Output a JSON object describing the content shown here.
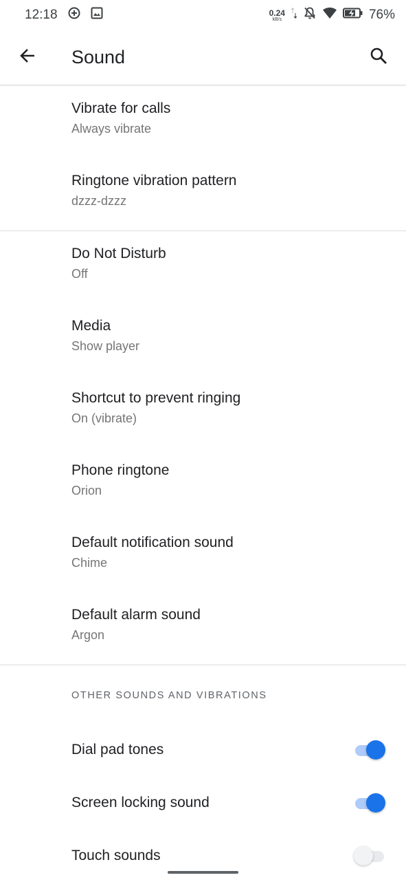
{
  "status_bar": {
    "time": "12:18",
    "net_speed_value": "0.24",
    "net_speed_unit": "kB/s",
    "battery": "76%",
    "icons": [
      "data-saver-icon",
      "image-icon",
      "upload-download-arrows-icon",
      "notifications-off-icon",
      "wifi-icon",
      "battery-charging-icon"
    ]
  },
  "app_bar": {
    "title": "Sound",
    "icons": [
      "back-arrow-icon",
      "search-icon"
    ]
  },
  "settings": {
    "vibrate_calls": {
      "title": "Vibrate for calls",
      "summary": "Always vibrate"
    },
    "ringtone_vibration": {
      "title": "Ringtone vibration pattern",
      "summary": "dzzz-dzzz"
    },
    "dnd": {
      "title": "Do Not Disturb",
      "summary": "Off"
    },
    "media": {
      "title": "Media",
      "summary": "Show player"
    },
    "prevent_ringing": {
      "title": "Shortcut to prevent ringing",
      "summary": "On (vibrate)"
    },
    "phone_ringtone": {
      "title": "Phone ringtone",
      "summary": "Orion"
    },
    "notification_sound": {
      "title": "Default notification sound",
      "summary": "Chime"
    },
    "alarm_sound": {
      "title": "Default alarm sound",
      "summary": "Argon"
    }
  },
  "other_section": {
    "header": "OTHER SOUNDS AND VIBRATIONS",
    "dial_pad": {
      "title": "Dial pad tones",
      "enabled": true
    },
    "screen_lock": {
      "title": "Screen locking sound",
      "enabled": true
    },
    "touch_sounds": {
      "title": "Touch sounds",
      "enabled": false
    }
  },
  "colors": {
    "accent": "#1a73e8",
    "accent_track": "#aecbfa",
    "primary_text": "#202124",
    "secondary_text": "#757575"
  }
}
